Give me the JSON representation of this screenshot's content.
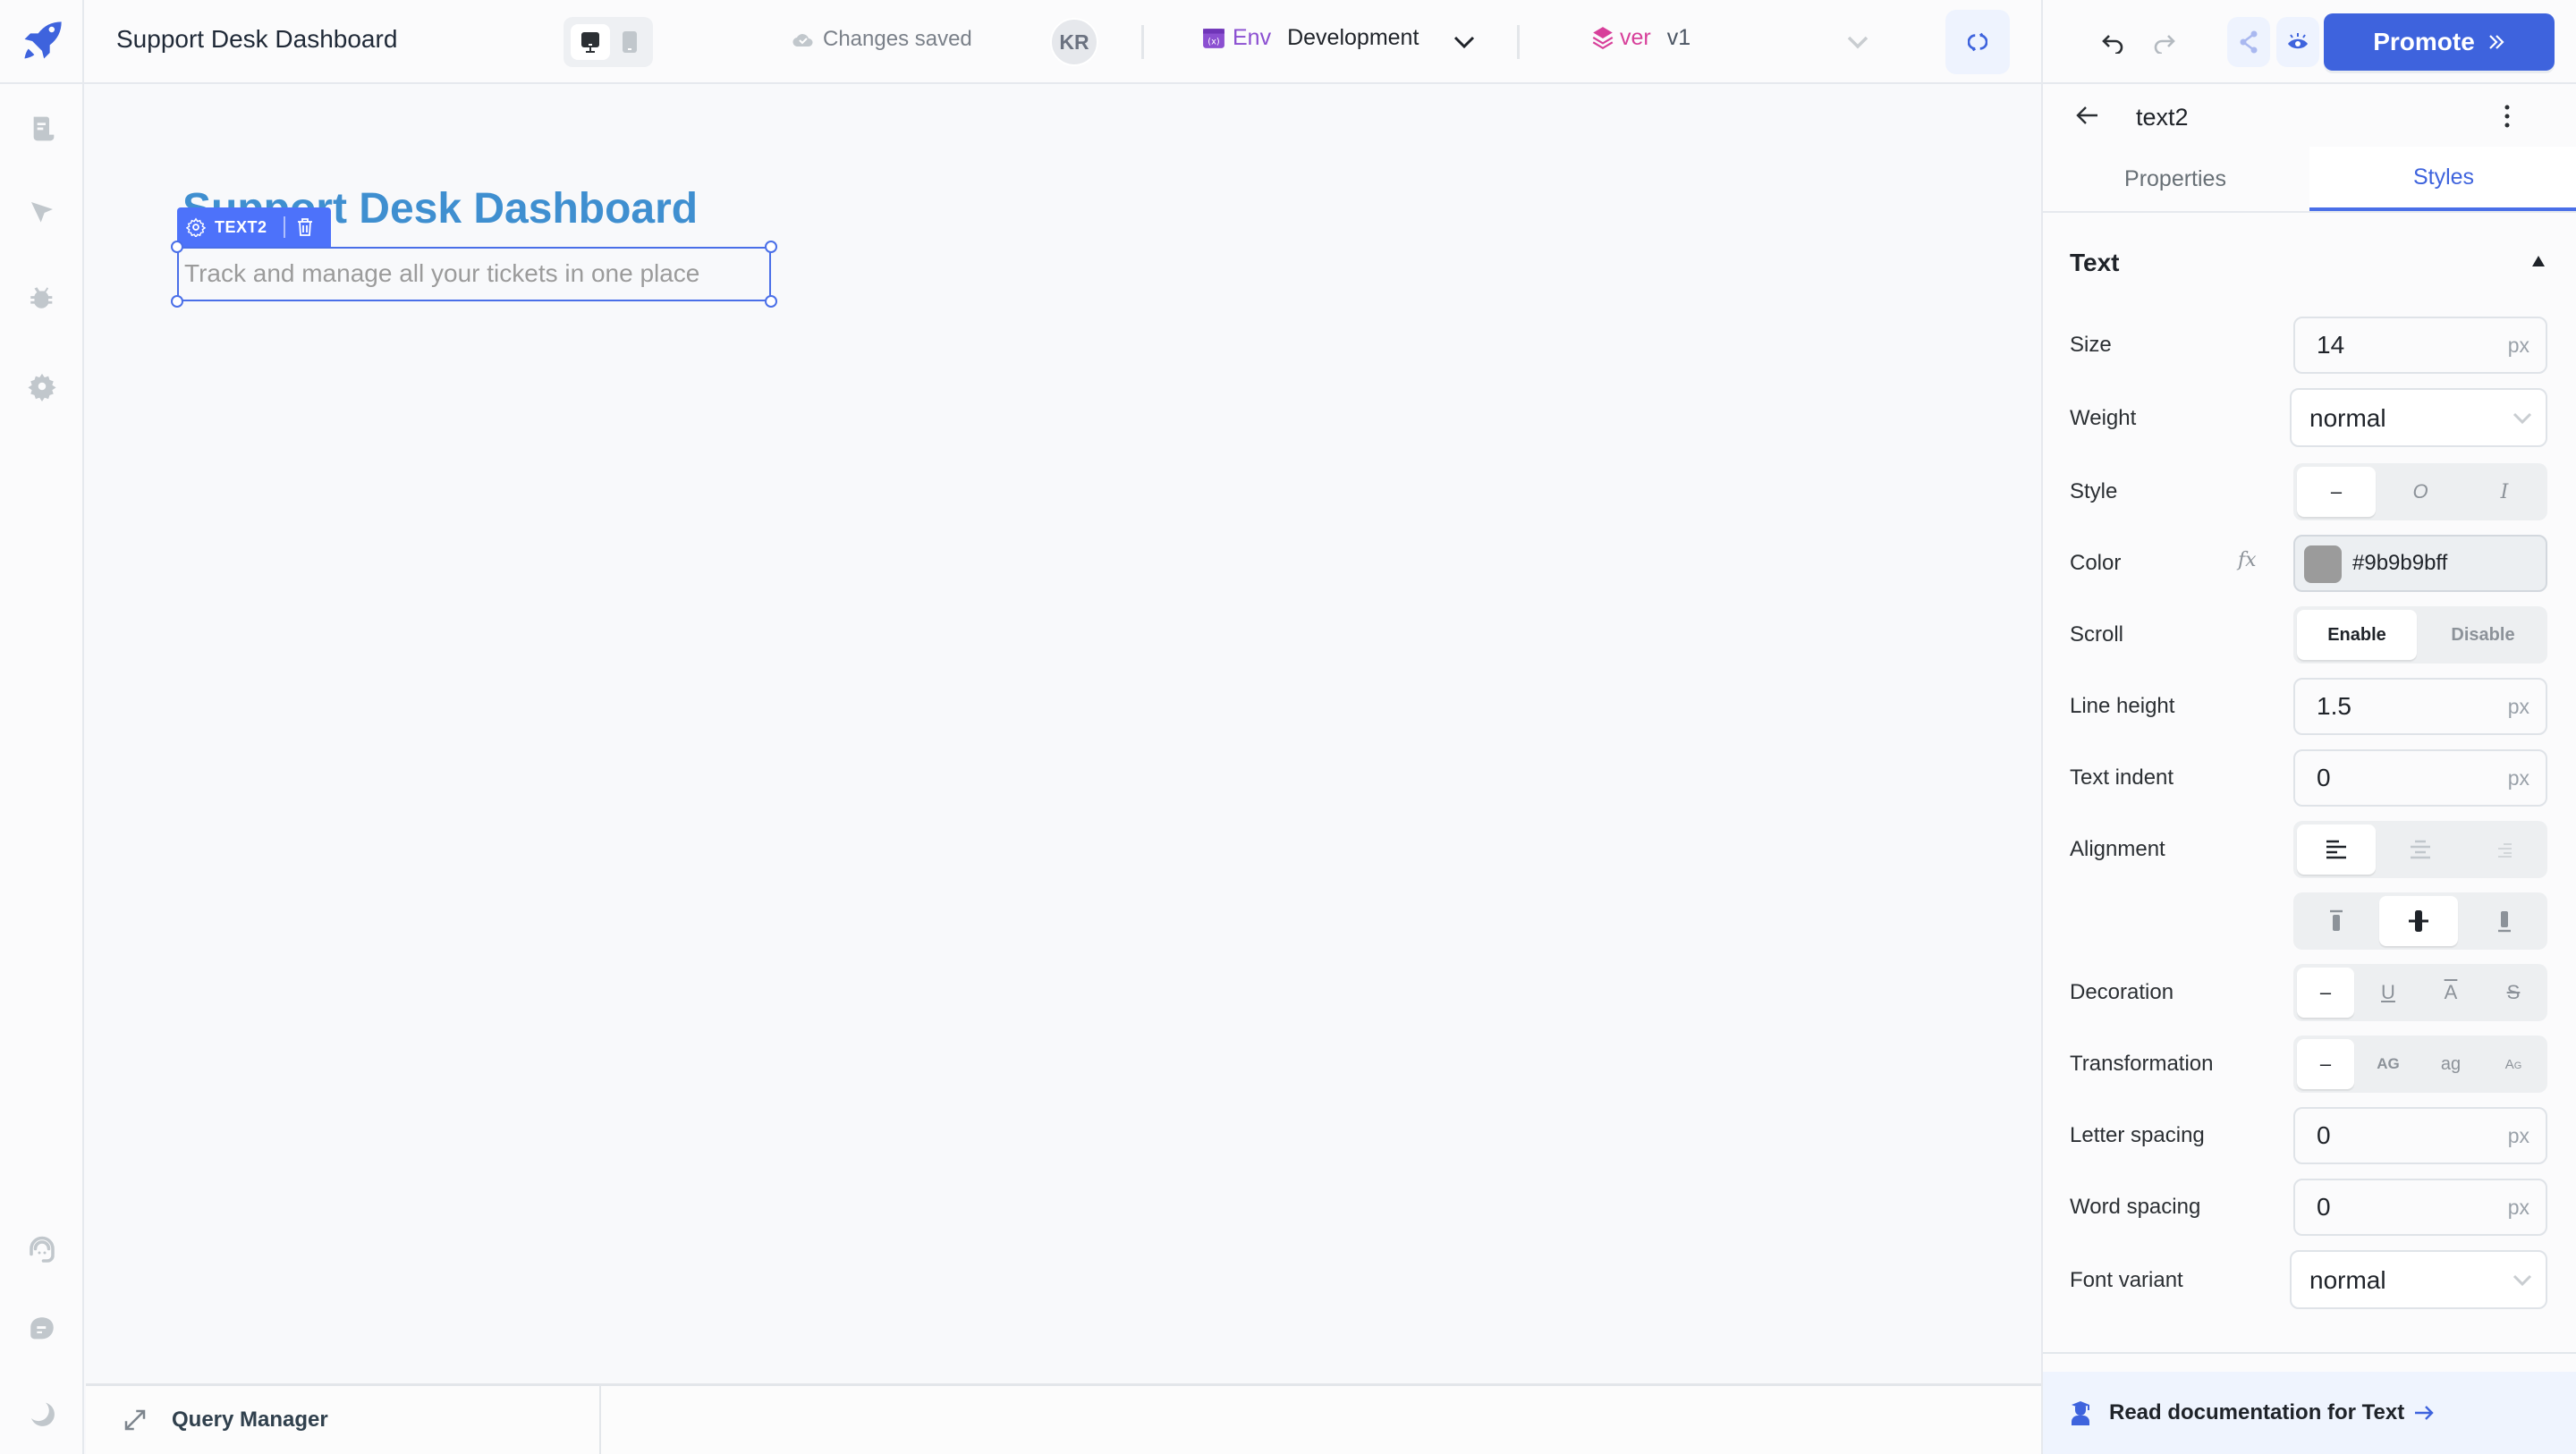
{
  "header": {
    "app_title": "Support Desk Dashboard",
    "save_status": "Changes saved",
    "avatar_initials": "KR",
    "env_label": "Env",
    "env_value": "Development",
    "version_label": "ver",
    "version_value": "v1",
    "promote_label": "Promote",
    "device_modes": [
      "desktop",
      "mobile"
    ],
    "active_device": "desktop"
  },
  "sidebar": {
    "top_items": [
      {
        "name": "pages",
        "icon": "page-icon"
      },
      {
        "name": "inspector",
        "icon": "pointer-icon"
      },
      {
        "name": "debugger",
        "icon": "bug-icon"
      },
      {
        "name": "settings",
        "icon": "gear-icon"
      }
    ],
    "bottom_items": [
      {
        "name": "support",
        "icon": "headset-icon"
      },
      {
        "name": "comments",
        "icon": "chat-icon"
      },
      {
        "name": "theme",
        "icon": "moon-icon"
      }
    ]
  },
  "canvas": {
    "title_text": "Support Desk Dashboard",
    "selected_component_tag": "TEXT2",
    "selected_text": "Track and manage all your tickets in one place"
  },
  "query_manager": {
    "label": "Query Manager"
  },
  "inspector": {
    "component_name": "text2",
    "tabs": [
      {
        "label": "Properties",
        "active": false
      },
      {
        "label": "Styles",
        "active": true
      }
    ],
    "section_title": "Text",
    "fields": {
      "size": {
        "label": "Size",
        "value": "14",
        "unit": "px"
      },
      "weight": {
        "label": "Weight",
        "value": "normal"
      },
      "style": {
        "label": "Style",
        "options": [
          "–",
          "O",
          "I"
        ],
        "selected": 0
      },
      "color": {
        "label": "Color",
        "value": "#9b9b9bff",
        "swatch": "#9b9b9b",
        "fx_label": "fx"
      },
      "scroll": {
        "label": "Scroll",
        "options": [
          "Enable",
          "Disable"
        ],
        "selected": 0
      },
      "line_height": {
        "label": "Line height",
        "value": "1.5",
        "unit": "px"
      },
      "text_indent": {
        "label": "Text indent",
        "value": "0",
        "unit": "px"
      },
      "alignment": {
        "label": "Alignment",
        "horizontal": [
          "left",
          "center",
          "right"
        ],
        "horizontal_selected": 0,
        "vertical": [
          "top",
          "middle",
          "bottom"
        ],
        "vertical_selected": 1
      },
      "decoration": {
        "label": "Decoration",
        "options": [
          "–",
          "U",
          "A",
          "S"
        ],
        "selected": 0
      },
      "transformation": {
        "label": "Transformation",
        "options": [
          "–",
          "AG",
          "ag",
          "Ag"
        ],
        "selected": 0
      },
      "letter_spacing": {
        "label": "Letter spacing",
        "value": "0",
        "unit": "px"
      },
      "word_spacing": {
        "label": "Word spacing",
        "value": "0",
        "unit": "px"
      },
      "font_variant": {
        "label": "Font variant",
        "value": "normal"
      }
    },
    "doc_link": "Read documentation for Text"
  },
  "colors": {
    "accent": "#3e63dd",
    "canvas_title": "#3f8fd0",
    "env": "#8b4fd1",
    "version": "#d73f9a",
    "selection": "#4d72fa"
  }
}
